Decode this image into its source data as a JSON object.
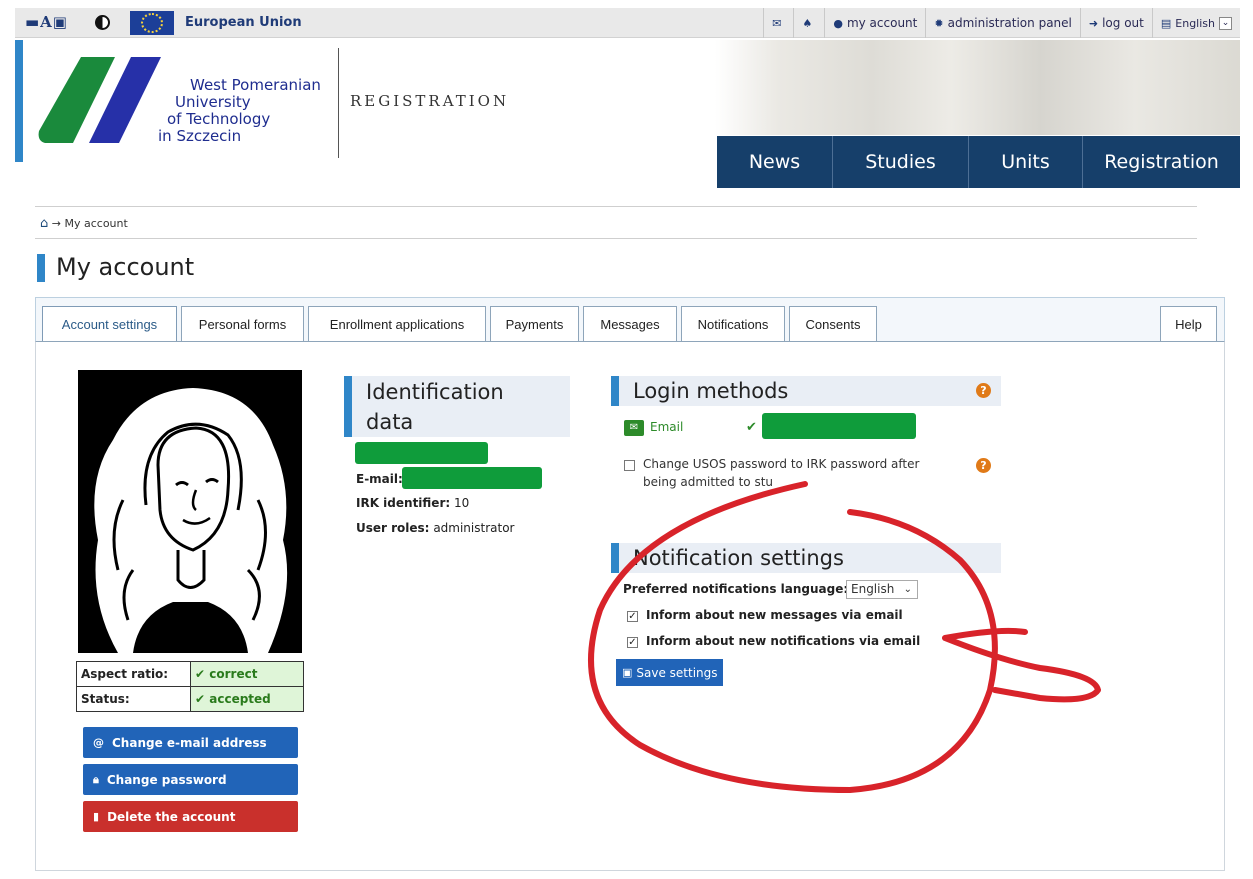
{
  "topbar": {
    "accessibility_text": "▬A▣",
    "eu_label": "European Union",
    "items": [
      {
        "icon": "envelope-icon",
        "label": ""
      },
      {
        "icon": "bell-icon",
        "label": ""
      },
      {
        "icon": "user-icon",
        "label": "my account"
      },
      {
        "icon": "gear-icon",
        "label": "administration panel"
      },
      {
        "icon": "logout-icon",
        "label": "log out"
      },
      {
        "icon": "language-icon",
        "label": "English"
      }
    ]
  },
  "header": {
    "uni_lines": [
      "West Pomeranian",
      "University",
      "of Technology",
      "in Szczecin"
    ],
    "subtitle": "REGISTRATION",
    "nav": [
      "News",
      "Studies",
      "Units",
      "Registration"
    ]
  },
  "breadcrumb": {
    "current": "My account"
  },
  "page_title": "My account",
  "tabs": [
    "Account settings",
    "Personal forms",
    "Enrollment applications",
    "Payments",
    "Messages",
    "Notifications",
    "Consents"
  ],
  "help_tab": "Help",
  "photo_status": [
    {
      "label": "Aspect ratio:",
      "value": "correct"
    },
    {
      "label": "Status:",
      "value": "accepted"
    }
  ],
  "account_buttons": {
    "change_email": "Change e-mail address",
    "change_password": "Change password",
    "delete_account": "Delete the account"
  },
  "identification": {
    "title_line1": "Identification",
    "title_line2": "data",
    "email_label": "E-mail:",
    "irk_label": "IRK identifier:",
    "irk_value": "10",
    "roles_label": "User roles:",
    "roles_value": "administrator"
  },
  "login_methods": {
    "title": "Login methods",
    "method": "Email",
    "change_pw_line1": "Change USOS password to IRK password after",
    "change_pw_line2": "being admitted to stu"
  },
  "notification_settings": {
    "title": "Notification settings",
    "language_label": "Preferred notifications language:",
    "language_value": "English",
    "opt_messages": "Inform about new messages via email",
    "opt_notifications": "Inform about new notifications via email",
    "save_label": "Save settings"
  },
  "colors": {
    "nav_bg": "#163f6a",
    "accent": "#2f86c8",
    "primary_button": "#2164b8",
    "danger_button": "#c9302c",
    "success": "#2a7b1c",
    "annotation": "#d8232a"
  }
}
